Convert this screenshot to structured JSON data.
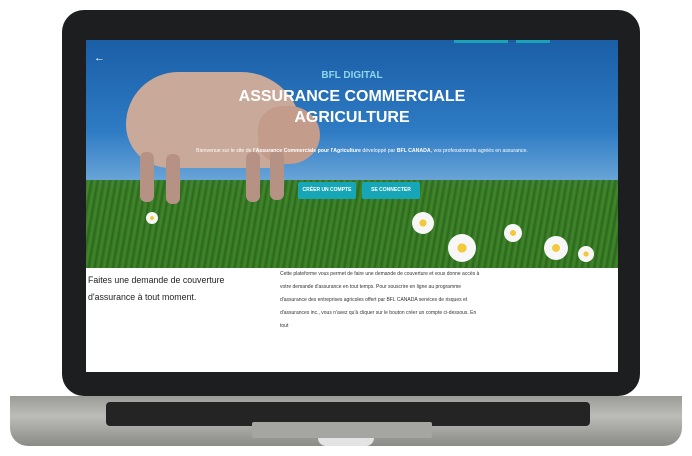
{
  "header": {
    "back_symbol": "←"
  },
  "hero": {
    "brand": "BFL DIGITAL",
    "title_line1": "ASSURANCE COMMERCIALE",
    "title_line2": "AGRICULTURE",
    "intro_part1": "Bienvenue sur le site de ",
    "intro_bold1": "l'Assurance Commerciale pour l'Agriculture",
    "intro_part2": " développé par ",
    "intro_bold2": "BFL CANADA",
    "intro_part3": ", vos professionnels agréés en assurance.",
    "create_account_label": "CRÉER UN COMPTE",
    "login_label": "SE CONNECTER"
  },
  "content": {
    "subtitle": "Faites une demande de couverture d'assurance à tout moment.",
    "body": "Cette plateforme vous permet de faire une demande de couverture et vous donne accès à votre demande d'assurance en tout temps. Pour souscrire en ligne au programme d'assurance des entreprises agricoles offert par BFL CANADA services de risques et d'assurances inc., vous n'avez qu'à cliquer sur le bouton créer un compte ci-dessous. En tout"
  },
  "colors": {
    "accent": "#17a6b7",
    "brand_text": "#8fd5ec"
  }
}
